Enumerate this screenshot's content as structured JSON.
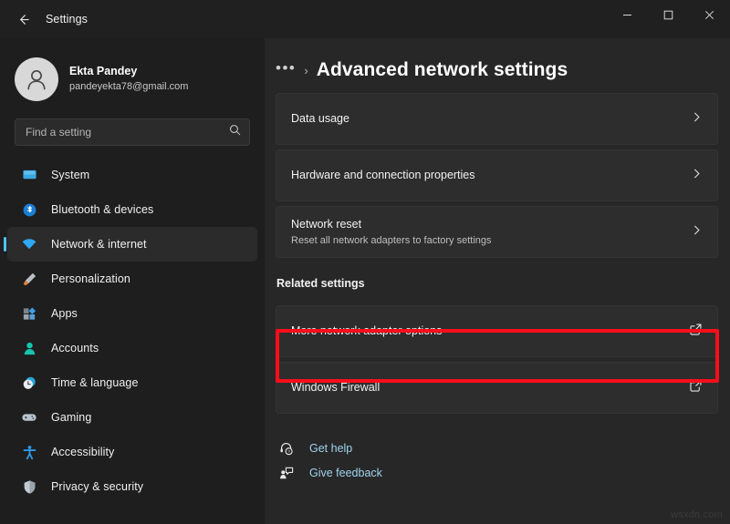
{
  "window": {
    "title": "Settings",
    "back_icon": "back-arrow-icon",
    "controls": {
      "minimize": "minimize-icon",
      "maximize": "maximize-icon",
      "close": "close-icon"
    }
  },
  "account": {
    "name": "Ekta Pandey",
    "email": "pandeyekta78@gmail.com",
    "avatar_icon": "person-avatar-icon"
  },
  "search": {
    "placeholder": "Find a setting",
    "icon": "search-icon"
  },
  "sidebar": {
    "items": [
      {
        "label": "System",
        "icon": "system-monitor-icon",
        "color": "#3ba7e0",
        "selected": false
      },
      {
        "label": "Bluetooth & devices",
        "icon": "bluetooth-icon",
        "color": "#1a7fd4",
        "selected": false
      },
      {
        "label": "Network & internet",
        "icon": "wifi-icon",
        "color": "#2fa8f5",
        "selected": true
      },
      {
        "label": "Personalization",
        "icon": "paintbrush-icon",
        "color": "#e8833a",
        "selected": false
      },
      {
        "label": "Apps",
        "icon": "apps-grid-icon",
        "color": "#5a9fd4",
        "selected": false
      },
      {
        "label": "Accounts",
        "icon": "person-icon",
        "color": "#18c4b0",
        "selected": false
      },
      {
        "label": "Time & language",
        "icon": "clock-icon",
        "color": "#2aa5d8",
        "selected": false
      },
      {
        "label": "Gaming",
        "icon": "gamepad-icon",
        "color": "#b9c3cc",
        "selected": false
      },
      {
        "label": "Accessibility",
        "icon": "accessibility-person-icon",
        "color": "#2e9ae6",
        "selected": false
      },
      {
        "label": "Privacy & security",
        "icon": "shield-icon",
        "color": "#c3cbd2",
        "selected": false
      }
    ]
  },
  "main": {
    "breadcrumb": {
      "overflow": "•••",
      "separator": "›"
    },
    "title": "Advanced network settings",
    "cards": [
      {
        "title": "Data usage",
        "subtitle": "",
        "action_icon": "chevron-right-icon",
        "highlighted": false
      },
      {
        "title": "Hardware and connection properties",
        "subtitle": "",
        "action_icon": "chevron-right-icon",
        "highlighted": false
      },
      {
        "title": "Network reset",
        "subtitle": "Reset all network adapters to factory settings",
        "action_icon": "chevron-right-icon",
        "highlighted": false
      }
    ],
    "related_label": "Related settings",
    "related_cards": [
      {
        "title": "More network adapter options",
        "subtitle": "",
        "action_icon": "external-link-icon",
        "highlighted": true
      },
      {
        "title": "Windows Firewall",
        "subtitle": "",
        "action_icon": "external-link-icon",
        "highlighted": false
      }
    ],
    "footer_links": [
      {
        "label": "Get help",
        "icon": "help-headset-icon"
      },
      {
        "label": "Give feedback",
        "icon": "feedback-person-icon"
      }
    ]
  },
  "annotation": {
    "color": "#fb0d1b",
    "target": "More network adapter options"
  },
  "watermark": "wsxdn.com"
}
